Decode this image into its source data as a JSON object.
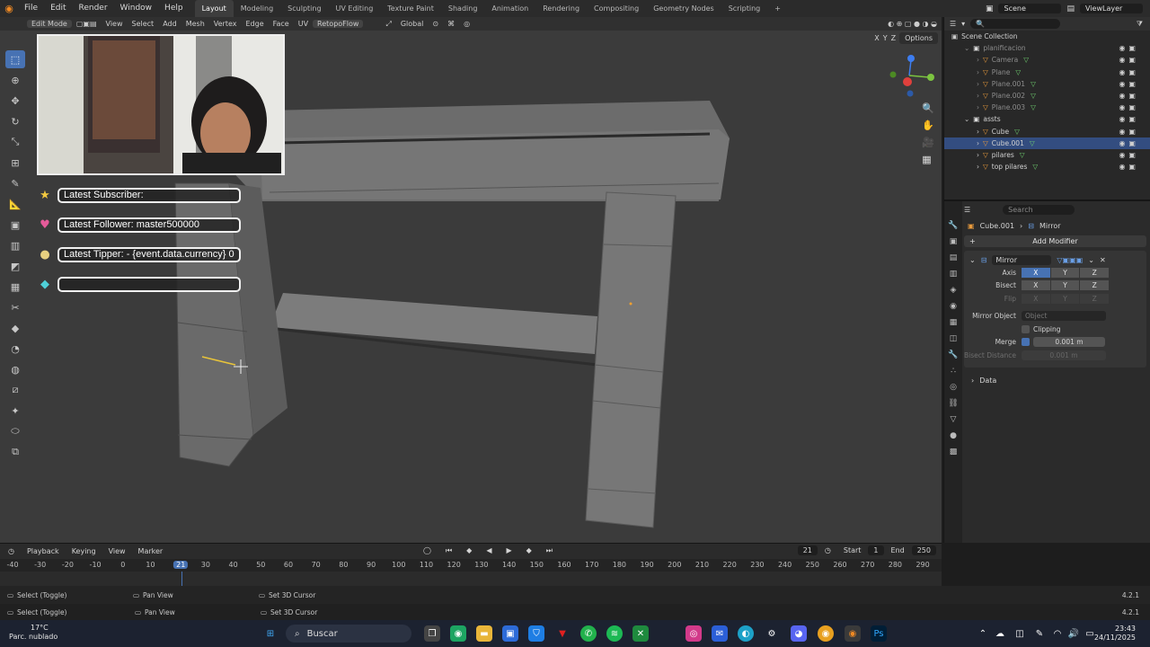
{
  "topbar": {
    "menu": [
      "File",
      "Edit",
      "Render",
      "Window",
      "Help"
    ],
    "tabs": [
      "Layout",
      "Modeling",
      "Sculpting",
      "UV Editing",
      "Texture Paint",
      "Shading",
      "Animation",
      "Rendering",
      "Compositing",
      "Geometry Nodes",
      "Scripting"
    ],
    "active_tab": "Layout",
    "add_tab": "+",
    "scene": "Scene",
    "view_layer": "ViewLayer"
  },
  "viewport_header": {
    "mode": "Edit Mode",
    "menus": [
      "View",
      "Select",
      "Add",
      "Mesh",
      "Vertex",
      "Edge",
      "Face",
      "UV"
    ],
    "retopoflow": "RetopoFlow",
    "transform_orientation": "Global",
    "options": "Options",
    "axes": [
      "X",
      "Y",
      "Z"
    ]
  },
  "stream_overlay": {
    "subscriber": "Latest Subscriber:",
    "follower": "Latest Follower: master500000",
    "tipper": "Latest Tipper:  - {event.data.currency} 0",
    "empty": ""
  },
  "outliner": {
    "header_title": "Scene Collection",
    "items": [
      {
        "label": "planificacion",
        "indent": 1,
        "type": "collection",
        "dim": true
      },
      {
        "label": "Camera",
        "indent": 2,
        "type": "camera",
        "dim": true
      },
      {
        "label": "Plane",
        "indent": 2,
        "type": "mesh",
        "dim": true
      },
      {
        "label": "Plane.001",
        "indent": 2,
        "type": "mesh",
        "dim": true
      },
      {
        "label": "Plane.002",
        "indent": 2,
        "type": "mesh",
        "dim": true
      },
      {
        "label": "Plane.003",
        "indent": 2,
        "type": "mesh",
        "dim": true
      },
      {
        "label": "assts",
        "indent": 1,
        "type": "collection",
        "dim": false
      },
      {
        "label": "Cube",
        "indent": 2,
        "type": "mesh",
        "dim": false
      },
      {
        "label": "Cube.001",
        "indent": 2,
        "type": "mesh",
        "dim": false,
        "selected": true
      },
      {
        "label": "pilares",
        "indent": 2,
        "type": "mesh",
        "dim": false
      },
      {
        "label": "top pilares",
        "indent": 2,
        "type": "mesh",
        "dim": false
      }
    ]
  },
  "properties": {
    "search_placeholder": "Search",
    "object_name": "Cube.001",
    "modifier_crumb": "Mirror",
    "add_modifier": "Add Modifier",
    "modifier_name": "Mirror",
    "axis_label": "Axis",
    "bisect_label": "Bisect",
    "flip_label": "Flip",
    "axis_values": [
      "X",
      "Y",
      "Z"
    ],
    "mirror_object_label": "Mirror Object",
    "mirror_object_placeholder": "Object",
    "clipping_label": "Clipping",
    "merge_label": "Merge",
    "merge_value": "0.001 m",
    "bisect_distance_label": "Bisect Distance",
    "bisect_distance_value": "0.001 m",
    "data_label": "Data"
  },
  "timeline": {
    "menus": [
      "Playback",
      "Keying",
      "View",
      "Marker"
    ],
    "current_frame": "21",
    "start_label": "Start",
    "start_value": "1",
    "end_label": "End",
    "end_value": "250",
    "ruler": [
      "-40",
      "-30",
      "-20",
      "-10",
      "0",
      "10",
      "21",
      "30",
      "40",
      "50",
      "60",
      "70",
      "80",
      "90",
      "100",
      "110",
      "120",
      "130",
      "140",
      "150",
      "160",
      "170",
      "180",
      "190",
      "200",
      "210",
      "220",
      "230",
      "240",
      "250",
      "260",
      "270",
      "280",
      "290"
    ]
  },
  "status": {
    "select": "Select (Toggle)",
    "pan": "Pan View",
    "cursor": "Set 3D Cursor",
    "version": "4.2.1"
  },
  "taskbar": {
    "temperature": "17°C",
    "weather": "Parc. nublado",
    "search": "Buscar",
    "time": "23:43",
    "date": "24/11/2025"
  },
  "colors": {
    "accent": "#4772b3",
    "viewport_bg": "#3b3b3b",
    "panel_bg": "#2b2b2b"
  }
}
